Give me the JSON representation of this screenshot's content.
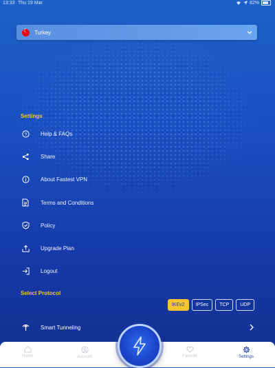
{
  "status_bar": {
    "time": "13:33",
    "date": "Thu 19 Mar",
    "battery": "82%"
  },
  "country_select": {
    "label": "Turkey"
  },
  "settings": {
    "title": "Settings",
    "items": [
      {
        "label": "Help & FAQs",
        "icon": "help-icon"
      },
      {
        "label": "Share",
        "icon": "share-icon"
      },
      {
        "label": "About Fastest VPN",
        "icon": "info-icon"
      },
      {
        "label": "Terms and Conditions",
        "icon": "document-icon"
      },
      {
        "label": "Policy",
        "icon": "shield-check-icon"
      },
      {
        "label": "Upgrade Plan",
        "icon": "upload-icon"
      },
      {
        "label": "Logout",
        "icon": "logout-icon"
      }
    ]
  },
  "protocol": {
    "title": "Select Protocol",
    "options": [
      "IKEv2",
      "IPSec",
      "TCP",
      "UDP"
    ],
    "selected": "IKEv2"
  },
  "smart_tunneling": {
    "label": "Smart Tunneling"
  },
  "bottom_nav": {
    "items": [
      {
        "label": "Home"
      },
      {
        "label": "Account"
      },
      {
        "label": "Favorite"
      },
      {
        "label": "Settings"
      }
    ],
    "active": "Settings"
  },
  "colors": {
    "accent": "#f6c431",
    "background_top": "#1d62c9",
    "background_bottom": "#12308f"
  }
}
